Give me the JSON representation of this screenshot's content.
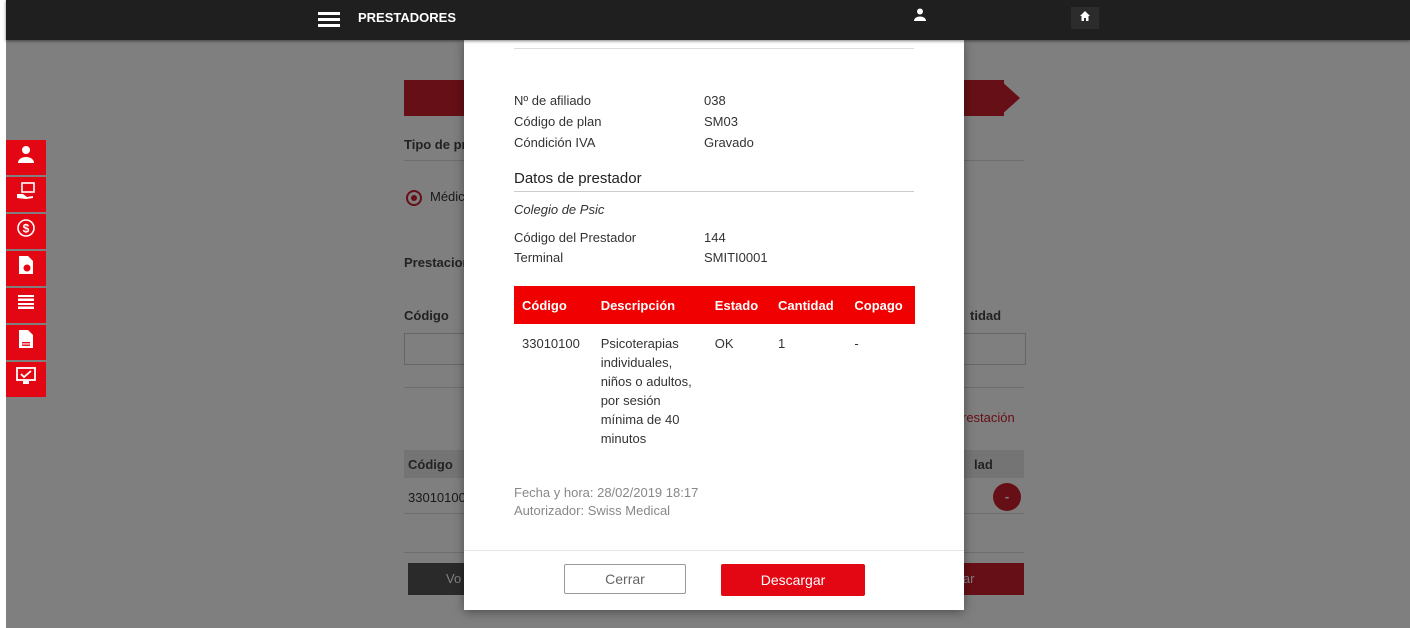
{
  "header": {
    "title": "PRESTADORES",
    "menu_icon": "hamburger-icon",
    "user_icon": "user-icon",
    "home_icon": "home-icon"
  },
  "sidebar": {
    "items": [
      {
        "icon": "user-icon",
        "glyph": "👤"
      },
      {
        "icon": "hand-card-icon",
        "glyph": "🤝"
      },
      {
        "icon": "dollar-icon",
        "glyph": "$"
      },
      {
        "icon": "document-clock-icon",
        "glyph": "🕒"
      },
      {
        "icon": "card-stack-icon",
        "glyph": "▤"
      },
      {
        "icon": "document-icon",
        "glyph": "▦"
      },
      {
        "icon": "monitor-check-icon",
        "glyph": "☑"
      }
    ]
  },
  "background": {
    "tipo_label": "Tipo de pr",
    "radio_label": "Médic",
    "prestaciones_label": "Prestacion",
    "codigo_label": "Código",
    "cantidad_label": "tidad",
    "add_link": "restación",
    "table_codigo": "Código",
    "table_cantidad": "lad",
    "row_codigo": "33010100",
    "left_button": "Vo",
    "right_button": "iar"
  },
  "modal": {
    "afiliado": {
      "rows": [
        {
          "label": "Nº de afiliado",
          "value": "038"
        },
        {
          "label": "Código de plan",
          "value": "SM03"
        },
        {
          "label": "Cóndición IVA",
          "value": "Gravado"
        }
      ]
    },
    "prestador_title": "Datos de prestador",
    "prestador_name": "Colegio de Psic",
    "prestador": {
      "rows": [
        {
          "label": "Código del Prestador",
          "value": "144"
        },
        {
          "label": "Terminal",
          "value": "SMITI0001"
        }
      ]
    },
    "table": {
      "headers": [
        "Código",
        "Descripción",
        "Estado",
        "Cantidad",
        "Copago"
      ],
      "rows": [
        {
          "codigo": "33010100",
          "descripcion": [
            "Psicoterapias",
            "individuales,",
            "niños o adultos,",
            "por sesión",
            "mínima de 40",
            "minutos"
          ],
          "estado": "OK",
          "cantidad": "1",
          "copago": "-"
        }
      ]
    },
    "fecha": "Fecha y hora: 28/02/2019 18:17",
    "autorizador": "Autorizador: Swiss Medical",
    "buttons": {
      "cerrar": "Cerrar",
      "descargar": "Descargar"
    }
  },
  "colors": {
    "brand_red": "#e30613",
    "header_bg": "#1f1f1f"
  }
}
